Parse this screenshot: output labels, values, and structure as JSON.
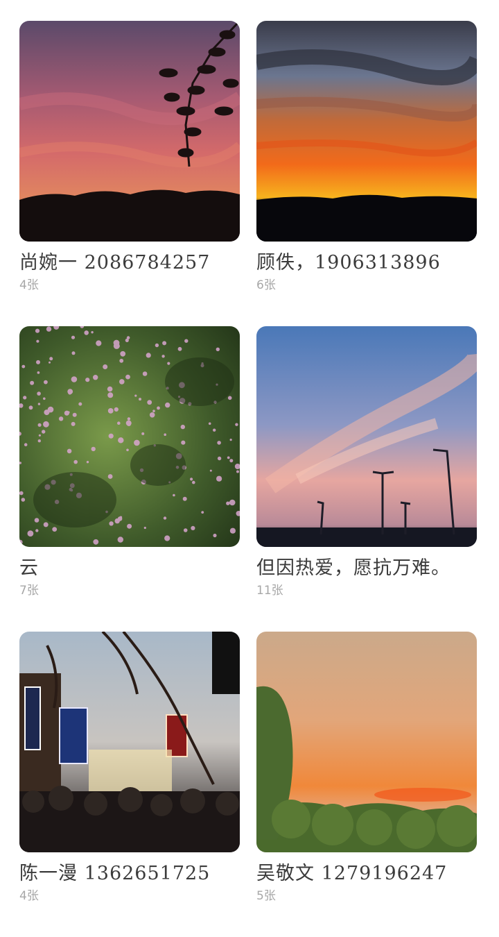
{
  "albums": [
    {
      "title": "尚婉一 2086784257",
      "count": "4张",
      "photo": "dusk-tree-silhouette"
    },
    {
      "title": "顾佚，1906313896",
      "count": "6张",
      "photo": "orange-sunset-clouds"
    },
    {
      "title": "云",
      "count": "7张",
      "photo": "pink-flower-bush"
    },
    {
      "title": "但因热爱，愿抗万难。",
      "count": "11张",
      "photo": "pink-sky-streetlights"
    },
    {
      "title": "陈一漫 1362651725",
      "count": "4张",
      "photo": "night-market-street"
    },
    {
      "title": "吴敬文 1279196247",
      "count": "5张",
      "photo": "orange-sky-treeline"
    }
  ]
}
